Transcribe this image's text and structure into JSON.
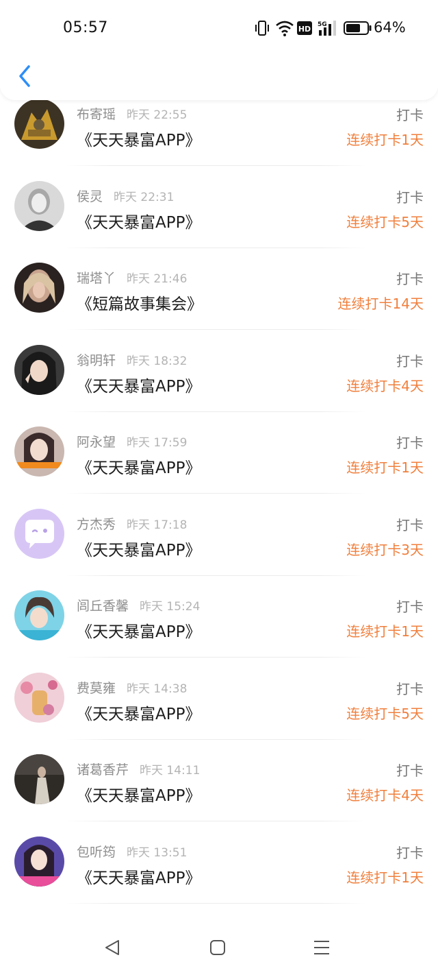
{
  "status_bar": {
    "time": "05:57",
    "battery_percent": "64%",
    "icons": [
      "vibrate-icon",
      "wifi-icon",
      "hd-icon",
      "5g-signal-icon",
      "battery-icon"
    ]
  },
  "header": {
    "back_icon": "chevron-left-icon",
    "accent_color": "#2c8ef8"
  },
  "entries": [
    {
      "name": "布寄瑶",
      "time": "昨天 22:55",
      "book": "《天天暴富APP》",
      "action": "打卡",
      "streak": "连续打卡1天"
    },
    {
      "name": "侯灵",
      "time": "昨天 22:31",
      "book": "《天天暴富APP》",
      "action": "打卡",
      "streak": "连续打卡5天"
    },
    {
      "name": "瑞塔丫",
      "time": "昨天 21:46",
      "book": "《短篇故事集会》",
      "action": "打卡",
      "streak": "连续打卡14天"
    },
    {
      "name": "翁明轩",
      "time": "昨天 18:32",
      "book": "《天天暴富APP》",
      "action": "打卡",
      "streak": "连续打卡4天"
    },
    {
      "name": "阿永望",
      "time": "昨天 17:59",
      "book": "《天天暴富APP》",
      "action": "打卡",
      "streak": "连续打卡1天"
    },
    {
      "name": "方杰秀",
      "time": "昨天 17:18",
      "book": "《天天暴富APP》",
      "action": "打卡",
      "streak": "连续打卡3天"
    },
    {
      "name": "闾丘香馨",
      "time": "昨天 15:24",
      "book": "《天天暴富APP》",
      "action": "打卡",
      "streak": "连续打卡1天"
    },
    {
      "name": "费莫雍",
      "time": "昨天 14:38",
      "book": "《天天暴富APP》",
      "action": "打卡",
      "streak": "连续打卡5天"
    },
    {
      "name": "诸葛香芹",
      "time": "昨天 14:11",
      "book": "《天天暴富APP》",
      "action": "打卡",
      "streak": "连续打卡4天"
    },
    {
      "name": "包听筠",
      "time": "昨天 13:51",
      "book": "《天天暴富APP》",
      "action": "打卡",
      "streak": "连续打卡1天"
    }
  ],
  "colors": {
    "streak": "#f07f3c",
    "name": "#8e8e8e",
    "time": "#b4b4b4"
  },
  "nav_bar": {
    "icons": [
      "back-triangle-icon",
      "home-square-icon",
      "menu-lines-icon"
    ]
  }
}
